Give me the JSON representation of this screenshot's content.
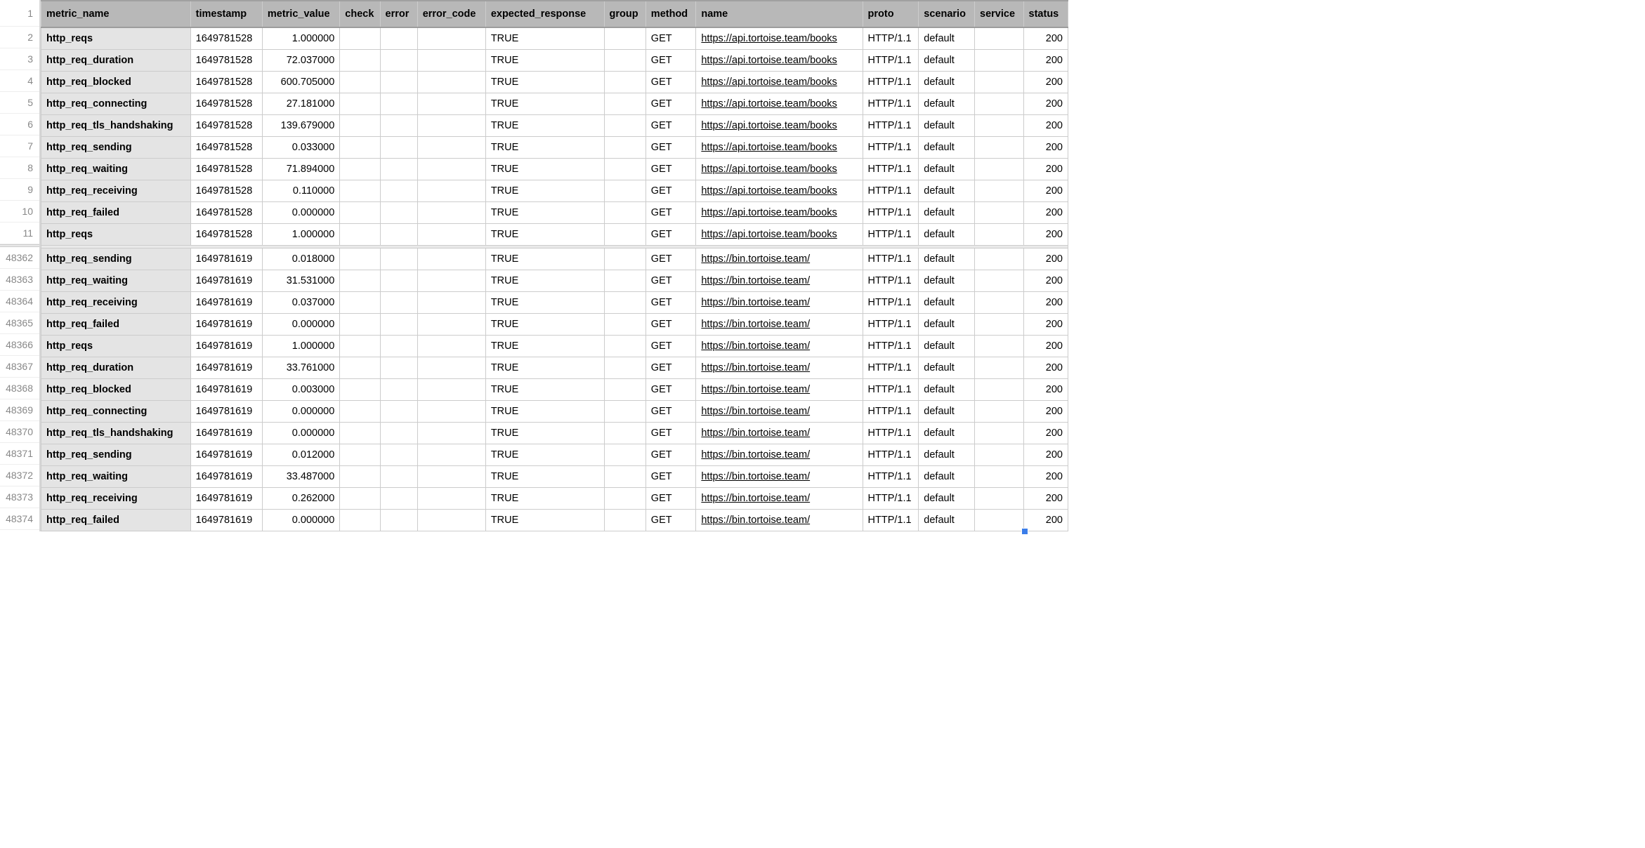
{
  "headers": {
    "metric_name": "metric_name",
    "timestamp": "timestamp",
    "metric_value": "metric_value",
    "check": "check",
    "error": "error",
    "error_code": "error_code",
    "expected_response": "expected_response",
    "group": "group",
    "method": "method",
    "name": "name",
    "proto": "proto",
    "scenario": "scenario",
    "service": "service",
    "status": "status"
  },
  "row_numbers_top": [
    "1",
    "2",
    "3",
    "4",
    "5",
    "6",
    "7",
    "8",
    "9",
    "10",
    "11"
  ],
  "row_numbers_bottom": [
    "48362",
    "48363",
    "48364",
    "48365",
    "48366",
    "48367",
    "48368",
    "48369",
    "48370",
    "48371",
    "48372",
    "48373",
    "48374"
  ],
  "rows_top": [
    {
      "metric_name": "http_reqs",
      "timestamp": "1649781528",
      "metric_value": "1.000000",
      "check": "",
      "error": "",
      "error_code": "",
      "expected_response": "TRUE",
      "group": "",
      "method": "GET",
      "name": "https://api.tortoise.team/books",
      "proto": "HTTP/1.1",
      "scenario": "default",
      "service": "",
      "status": "200"
    },
    {
      "metric_name": "http_req_duration",
      "timestamp": "1649781528",
      "metric_value": "72.037000",
      "check": "",
      "error": "",
      "error_code": "",
      "expected_response": "TRUE",
      "group": "",
      "method": "GET",
      "name": "https://api.tortoise.team/books",
      "proto": "HTTP/1.1",
      "scenario": "default",
      "service": "",
      "status": "200"
    },
    {
      "metric_name": "http_req_blocked",
      "timestamp": "1649781528",
      "metric_value": "600.705000",
      "check": "",
      "error": "",
      "error_code": "",
      "expected_response": "TRUE",
      "group": "",
      "method": "GET",
      "name": "https://api.tortoise.team/books",
      "proto": "HTTP/1.1",
      "scenario": "default",
      "service": "",
      "status": "200"
    },
    {
      "metric_name": "http_req_connecting",
      "timestamp": "1649781528",
      "metric_value": "27.181000",
      "check": "",
      "error": "",
      "error_code": "",
      "expected_response": "TRUE",
      "group": "",
      "method": "GET",
      "name": "https://api.tortoise.team/books",
      "proto": "HTTP/1.1",
      "scenario": "default",
      "service": "",
      "status": "200"
    },
    {
      "metric_name": "http_req_tls_handshaking",
      "timestamp": "1649781528",
      "metric_value": "139.679000",
      "check": "",
      "error": "",
      "error_code": "",
      "expected_response": "TRUE",
      "group": "",
      "method": "GET",
      "name": "https://api.tortoise.team/books",
      "proto": "HTTP/1.1",
      "scenario": "default",
      "service": "",
      "status": "200"
    },
    {
      "metric_name": "http_req_sending",
      "timestamp": "1649781528",
      "metric_value": "0.033000",
      "check": "",
      "error": "",
      "error_code": "",
      "expected_response": "TRUE",
      "group": "",
      "method": "GET",
      "name": "https://api.tortoise.team/books",
      "proto": "HTTP/1.1",
      "scenario": "default",
      "service": "",
      "status": "200"
    },
    {
      "metric_name": "http_req_waiting",
      "timestamp": "1649781528",
      "metric_value": "71.894000",
      "check": "",
      "error": "",
      "error_code": "",
      "expected_response": "TRUE",
      "group": "",
      "method": "GET",
      "name": "https://api.tortoise.team/books",
      "proto": "HTTP/1.1",
      "scenario": "default",
      "service": "",
      "status": "200"
    },
    {
      "metric_name": "http_req_receiving",
      "timestamp": "1649781528",
      "metric_value": "0.110000",
      "check": "",
      "error": "",
      "error_code": "",
      "expected_response": "TRUE",
      "group": "",
      "method": "GET",
      "name": "https://api.tortoise.team/books",
      "proto": "HTTP/1.1",
      "scenario": "default",
      "service": "",
      "status": "200"
    },
    {
      "metric_name": "http_req_failed",
      "timestamp": "1649781528",
      "metric_value": "0.000000",
      "check": "",
      "error": "",
      "error_code": "",
      "expected_response": "TRUE",
      "group": "",
      "method": "GET",
      "name": "https://api.tortoise.team/books",
      "proto": "HTTP/1.1",
      "scenario": "default",
      "service": "",
      "status": "200"
    },
    {
      "metric_name": "http_reqs",
      "timestamp": "1649781528",
      "metric_value": "1.000000",
      "check": "",
      "error": "",
      "error_code": "",
      "expected_response": "TRUE",
      "group": "",
      "method": "GET",
      "name": "https://api.tortoise.team/books",
      "proto": "HTTP/1.1",
      "scenario": "default",
      "service": "",
      "status": "200"
    }
  ],
  "rows_bottom": [
    {
      "metric_name": "http_req_sending",
      "timestamp": "1649781619",
      "metric_value": "0.018000",
      "check": "",
      "error": "",
      "error_code": "",
      "expected_response": "TRUE",
      "group": "",
      "method": "GET",
      "name": "https://bin.tortoise.team/",
      "proto": "HTTP/1.1",
      "scenario": "default",
      "service": "",
      "status": "200"
    },
    {
      "metric_name": "http_req_waiting",
      "timestamp": "1649781619",
      "metric_value": "31.531000",
      "check": "",
      "error": "",
      "error_code": "",
      "expected_response": "TRUE",
      "group": "",
      "method": "GET",
      "name": "https://bin.tortoise.team/",
      "proto": "HTTP/1.1",
      "scenario": "default",
      "service": "",
      "status": "200"
    },
    {
      "metric_name": "http_req_receiving",
      "timestamp": "1649781619",
      "metric_value": "0.037000",
      "check": "",
      "error": "",
      "error_code": "",
      "expected_response": "TRUE",
      "group": "",
      "method": "GET",
      "name": "https://bin.tortoise.team/",
      "proto": "HTTP/1.1",
      "scenario": "default",
      "service": "",
      "status": "200"
    },
    {
      "metric_name": "http_req_failed",
      "timestamp": "1649781619",
      "metric_value": "0.000000",
      "check": "",
      "error": "",
      "error_code": "",
      "expected_response": "TRUE",
      "group": "",
      "method": "GET",
      "name": "https://bin.tortoise.team/",
      "proto": "HTTP/1.1",
      "scenario": "default",
      "service": "",
      "status": "200"
    },
    {
      "metric_name": "http_reqs",
      "timestamp": "1649781619",
      "metric_value": "1.000000",
      "check": "",
      "error": "",
      "error_code": "",
      "expected_response": "TRUE",
      "group": "",
      "method": "GET",
      "name": "https://bin.tortoise.team/",
      "proto": "HTTP/1.1",
      "scenario": "default",
      "service": "",
      "status": "200"
    },
    {
      "metric_name": "http_req_duration",
      "timestamp": "1649781619",
      "metric_value": "33.761000",
      "check": "",
      "error": "",
      "error_code": "",
      "expected_response": "TRUE",
      "group": "",
      "method": "GET",
      "name": "https://bin.tortoise.team/",
      "proto": "HTTP/1.1",
      "scenario": "default",
      "service": "",
      "status": "200"
    },
    {
      "metric_name": "http_req_blocked",
      "timestamp": "1649781619",
      "metric_value": "0.003000",
      "check": "",
      "error": "",
      "error_code": "",
      "expected_response": "TRUE",
      "group": "",
      "method": "GET",
      "name": "https://bin.tortoise.team/",
      "proto": "HTTP/1.1",
      "scenario": "default",
      "service": "",
      "status": "200"
    },
    {
      "metric_name": "http_req_connecting",
      "timestamp": "1649781619",
      "metric_value": "0.000000",
      "check": "",
      "error": "",
      "error_code": "",
      "expected_response": "TRUE",
      "group": "",
      "method": "GET",
      "name": "https://bin.tortoise.team/",
      "proto": "HTTP/1.1",
      "scenario": "default",
      "service": "",
      "status": "200"
    },
    {
      "metric_name": "http_req_tls_handshaking",
      "timestamp": "1649781619",
      "metric_value": "0.000000",
      "check": "",
      "error": "",
      "error_code": "",
      "expected_response": "TRUE",
      "group": "",
      "method": "GET",
      "name": "https://bin.tortoise.team/",
      "proto": "HTTP/1.1",
      "scenario": "default",
      "service": "",
      "status": "200"
    },
    {
      "metric_name": "http_req_sending",
      "timestamp": "1649781619",
      "metric_value": "0.012000",
      "check": "",
      "error": "",
      "error_code": "",
      "expected_response": "TRUE",
      "group": "",
      "method": "GET",
      "name": "https://bin.tortoise.team/",
      "proto": "HTTP/1.1",
      "scenario": "default",
      "service": "",
      "status": "200"
    },
    {
      "metric_name": "http_req_waiting",
      "timestamp": "1649781619",
      "metric_value": "33.487000",
      "check": "",
      "error": "",
      "error_code": "",
      "expected_response": "TRUE",
      "group": "",
      "method": "GET",
      "name": "https://bin.tortoise.team/",
      "proto": "HTTP/1.1",
      "scenario": "default",
      "service": "",
      "status": "200"
    },
    {
      "metric_name": "http_req_receiving",
      "timestamp": "1649781619",
      "metric_value": "0.262000",
      "check": "",
      "error": "",
      "error_code": "",
      "expected_response": "TRUE",
      "group": "",
      "method": "GET",
      "name": "https://bin.tortoise.team/",
      "proto": "HTTP/1.1",
      "scenario": "default",
      "service": "",
      "status": "200"
    },
    {
      "metric_name": "http_req_failed",
      "timestamp": "1649781619",
      "metric_value": "0.000000",
      "check": "",
      "error": "",
      "error_code": "",
      "expected_response": "TRUE",
      "group": "",
      "method": "GET",
      "name": "https://bin.tortoise.team/",
      "proto": "HTTP/1.1",
      "scenario": "default",
      "service": "",
      "status": "200"
    }
  ]
}
